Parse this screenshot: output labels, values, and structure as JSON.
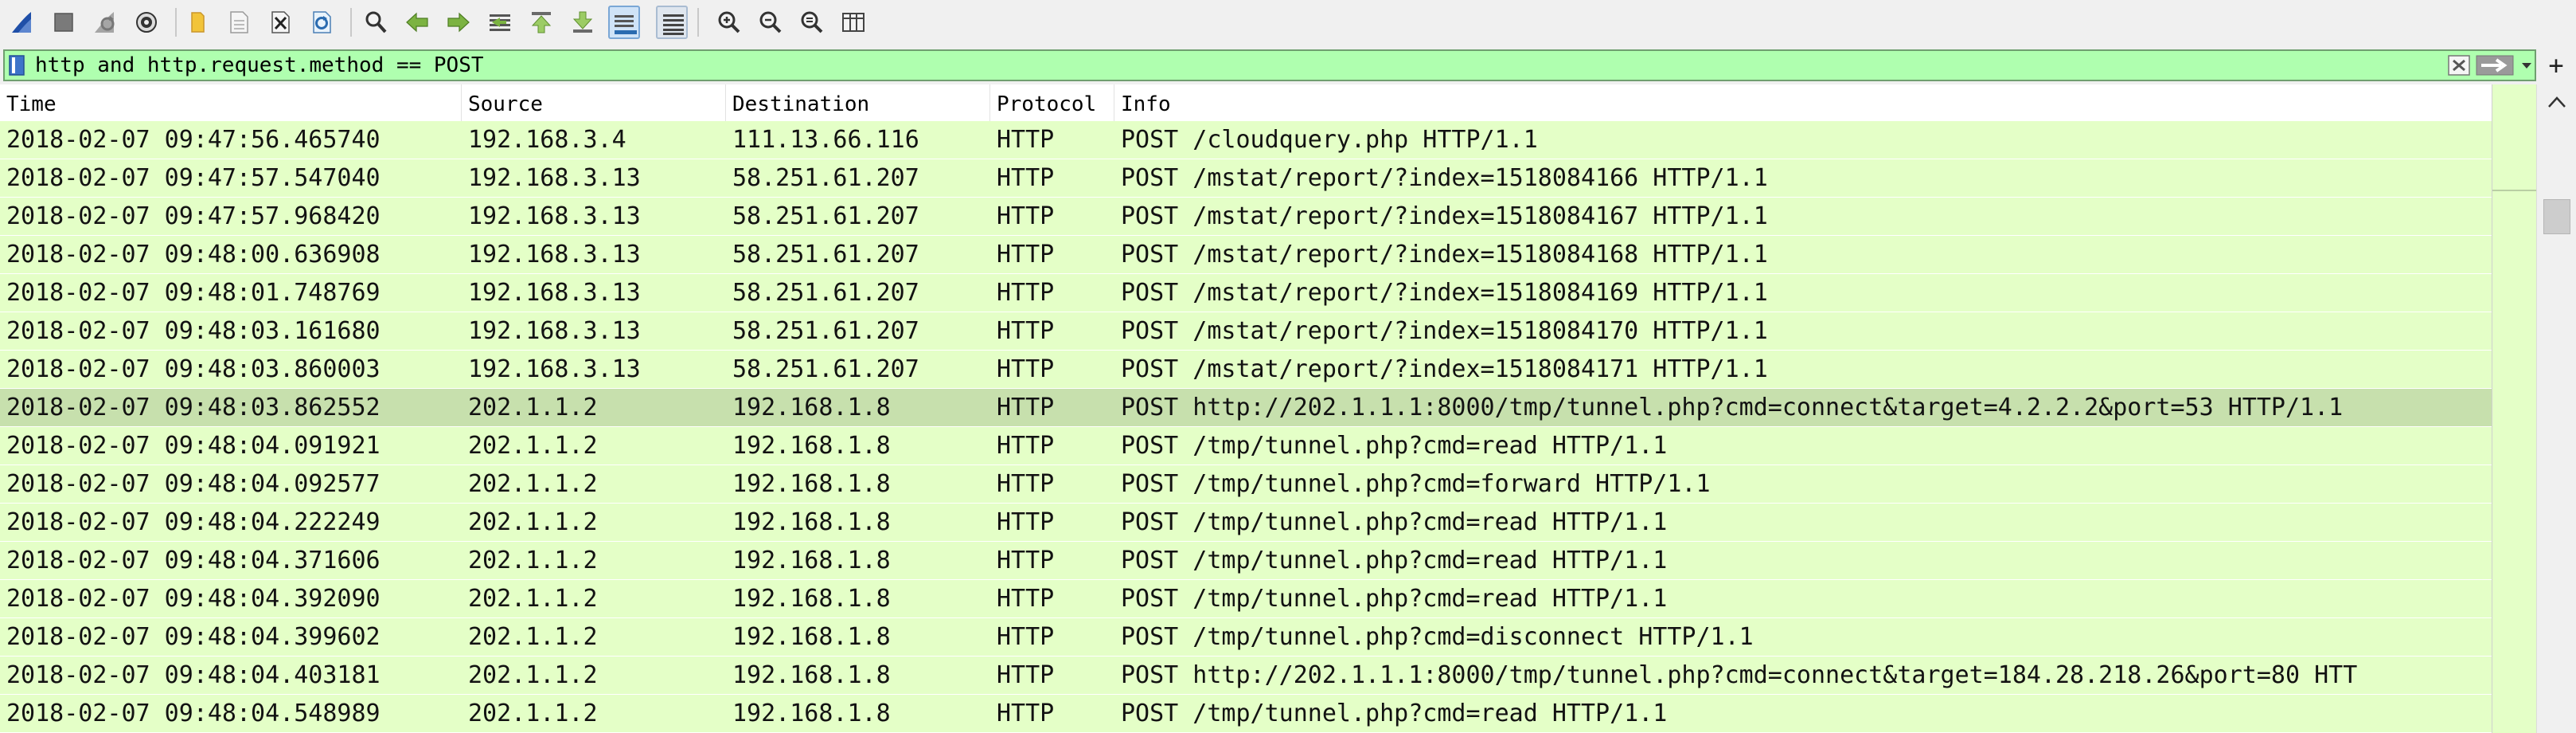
{
  "toolbar": {
    "buttons": [
      {
        "icon": "shark-fin-start-icon"
      },
      {
        "icon": "stop-capture-icon"
      },
      {
        "icon": "restart-capture-icon"
      },
      {
        "icon": "capture-options-icon"
      },
      {
        "icon": "open-file-icon"
      },
      {
        "icon": "save-file-icon"
      },
      {
        "icon": "close-file-icon"
      },
      {
        "icon": "reload-file-icon"
      },
      {
        "icon": "find-packet-icon"
      },
      {
        "icon": "go-back-icon"
      },
      {
        "icon": "go-forward-icon"
      },
      {
        "icon": "go-to-packet-icon"
      },
      {
        "icon": "first-packet-icon"
      },
      {
        "icon": "last-packet-icon"
      },
      {
        "icon": "auto-scroll-icon"
      },
      {
        "icon": "colorize-icon"
      },
      {
        "icon": "zoom-in-icon"
      },
      {
        "icon": "zoom-out-icon"
      },
      {
        "icon": "normal-size-icon"
      },
      {
        "icon": "resize-columns-icon"
      }
    ]
  },
  "filter": {
    "value": "http and http.request.method == POST",
    "plus_label": "+"
  },
  "columns": [
    "Time",
    "Source",
    "Destination",
    "Protocol",
    "Info"
  ],
  "packets": [
    {
      "time": "2018-02-07 09:47:56.465740",
      "source": "192.168.3.4",
      "destination": "111.13.66.116",
      "protocol": "HTTP",
      "info": "POST /cloudquery.php HTTP/1.1"
    },
    {
      "time": "2018-02-07 09:47:57.547040",
      "source": "192.168.3.13",
      "destination": "58.251.61.207",
      "protocol": "HTTP",
      "info": "POST /mstat/report/?index=1518084166 HTTP/1.1"
    },
    {
      "time": "2018-02-07 09:47:57.968420",
      "source": "192.168.3.13",
      "destination": "58.251.61.207",
      "protocol": "HTTP",
      "info": "POST /mstat/report/?index=1518084167 HTTP/1.1"
    },
    {
      "time": "2018-02-07 09:48:00.636908",
      "source": "192.168.3.13",
      "destination": "58.251.61.207",
      "protocol": "HTTP",
      "info": "POST /mstat/report/?index=1518084168 HTTP/1.1"
    },
    {
      "time": "2018-02-07 09:48:01.748769",
      "source": "192.168.3.13",
      "destination": "58.251.61.207",
      "protocol": "HTTP",
      "info": "POST /mstat/report/?index=1518084169 HTTP/1.1"
    },
    {
      "time": "2018-02-07 09:48:03.161680",
      "source": "192.168.3.13",
      "destination": "58.251.61.207",
      "protocol": "HTTP",
      "info": "POST /mstat/report/?index=1518084170 HTTP/1.1"
    },
    {
      "time": "2018-02-07 09:48:03.860003",
      "source": "192.168.3.13",
      "destination": "58.251.61.207",
      "protocol": "HTTP",
      "info": "POST /mstat/report/?index=1518084171 HTTP/1.1"
    },
    {
      "time": "2018-02-07 09:48:03.862552",
      "source": "202.1.1.2",
      "destination": "192.168.1.8",
      "protocol": "HTTP",
      "info": "POST http://202.1.1.1:8000/tmp/tunnel.php?cmd=connect&target=4.2.2.2&port=53 HTTP/1.1",
      "selected": true
    },
    {
      "time": "2018-02-07 09:48:04.091921",
      "source": "202.1.1.2",
      "destination": "192.168.1.8",
      "protocol": "HTTP",
      "info": "POST /tmp/tunnel.php?cmd=read HTTP/1.1"
    },
    {
      "time": "2018-02-07 09:48:04.092577",
      "source": "202.1.1.2",
      "destination": "192.168.1.8",
      "protocol": "HTTP",
      "info": "POST /tmp/tunnel.php?cmd=forward HTTP/1.1"
    },
    {
      "time": "2018-02-07 09:48:04.222249",
      "source": "202.1.1.2",
      "destination": "192.168.1.8",
      "protocol": "HTTP",
      "info": "POST /tmp/tunnel.php?cmd=read HTTP/1.1"
    },
    {
      "time": "2018-02-07 09:48:04.371606",
      "source": "202.1.1.2",
      "destination": "192.168.1.8",
      "protocol": "HTTP",
      "info": "POST /tmp/tunnel.php?cmd=read HTTP/1.1"
    },
    {
      "time": "2018-02-07 09:48:04.392090",
      "source": "202.1.1.2",
      "destination": "192.168.1.8",
      "protocol": "HTTP",
      "info": "POST /tmp/tunnel.php?cmd=read HTTP/1.1"
    },
    {
      "time": "2018-02-07 09:48:04.399602",
      "source": "202.1.1.2",
      "destination": "192.168.1.8",
      "protocol": "HTTP",
      "info": "POST /tmp/tunnel.php?cmd=disconnect HTTP/1.1"
    },
    {
      "time": "2018-02-07 09:48:04.403181",
      "source": "202.1.1.2",
      "destination": "192.168.1.8",
      "protocol": "HTTP",
      "info": "POST http://202.1.1.1:8000/tmp/tunnel.php?cmd=connect&target=184.28.218.26&port=80 HTT"
    },
    {
      "time": "2018-02-07 09:48:04.548989",
      "source": "202.1.1.2",
      "destination": "192.168.1.8",
      "protocol": "HTTP",
      "info": "POST /tmp/tunnel.php?cmd=read HTTP/1.1"
    }
  ],
  "colors": {
    "row_bg": "#e4ffc7",
    "row_selected_bg": "#c7e0ad",
    "filter_valid_bg": "#afffaf",
    "toolbar_bg": "#f0f0f0"
  }
}
